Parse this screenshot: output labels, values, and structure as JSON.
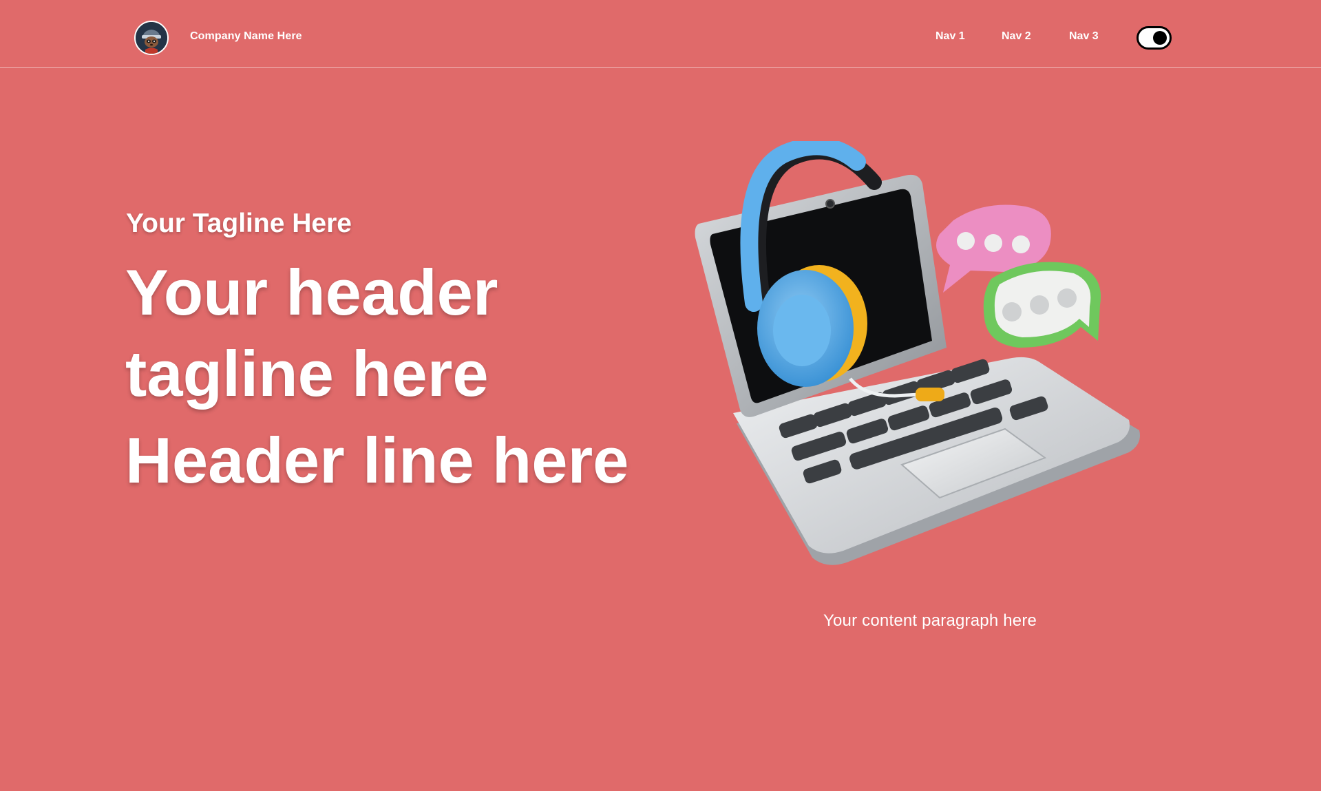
{
  "header": {
    "company_name": "Company Name Here",
    "nav": [
      "Nav 1",
      "Nav 2",
      "Nav 3"
    ],
    "logo_icon": "raccoon-mascot-avatar",
    "theme_toggle": {
      "icon": "toggle-switch-icon",
      "state": "on"
    }
  },
  "hero": {
    "tagline": "Your Tagline Here",
    "headline_lines": [
      "Your header",
      "tagline here",
      "Header line here"
    ],
    "paragraph": "Your content paragraph here",
    "illustration_icon": "laptop-headphones-chat-illustration"
  },
  "colors": {
    "background": "#e06a6a",
    "text": "#ffffff"
  }
}
